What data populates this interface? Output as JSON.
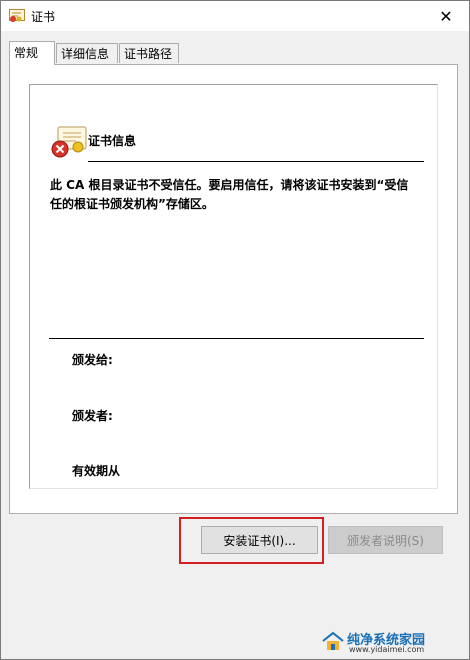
{
  "window": {
    "title": "证书",
    "close_glyph": "✕"
  },
  "tabs": [
    {
      "label": "常规",
      "active": true
    },
    {
      "label": "详细信息",
      "active": false
    },
    {
      "label": "证书路径",
      "active": false
    }
  ],
  "general": {
    "heading": "证书信息",
    "warning_line1": "此 CA 根目录证书不受信任。要启用信任，请将该证书安装到“受信",
    "warning_line2": "任的根证书颁发机构”存储区。",
    "issued_to_label": "颁发给:",
    "issued_by_label": "颁发者:",
    "valid_from_label": "有效期从"
  },
  "buttons": {
    "install_label": "安装证书(I)...",
    "issuer_statement_label": "颁发者说明(S)"
  },
  "watermark": {
    "name": "纯净系统家园",
    "url": "www.yidaimei.com"
  },
  "icons": {
    "app": "certificate-icon",
    "cert_error": "certificate-error-icon",
    "close": "close-icon"
  },
  "colors": {
    "highlight_border": "#d32020",
    "watermark_text": "#1a6fb5"
  }
}
